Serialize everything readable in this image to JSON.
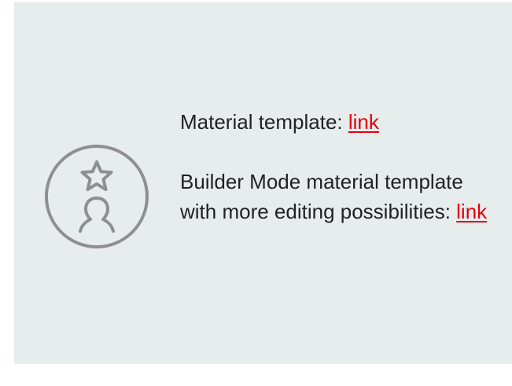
{
  "info_card": {
    "icon": "badge-star-person-icon",
    "colors": {
      "background": "#e7eced",
      "icon": "#8f8f8f",
      "text": "#222222",
      "link": "#e3000f"
    },
    "paragraphs": [
      {
        "text": "Material template: ",
        "link_label": "link"
      },
      {
        "text": "Builder Mode material template with more editing possibilities: ",
        "link_label": "link"
      }
    ]
  }
}
